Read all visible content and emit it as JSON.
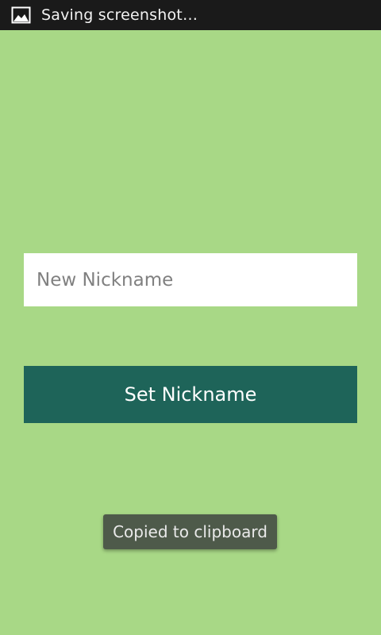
{
  "status_bar": {
    "icon": "image-icon",
    "text": "Saving screenshot…",
    "background_color": "#1a1a1a"
  },
  "form": {
    "nickname_input": {
      "value": "",
      "placeholder": "New Nickname"
    },
    "submit_label": "Set Nickname"
  },
  "toast": {
    "text": "Copied to clipboard"
  },
  "colors": {
    "background": "#a8d886",
    "button": "#1e6459",
    "toast": "#4e5a4a"
  }
}
